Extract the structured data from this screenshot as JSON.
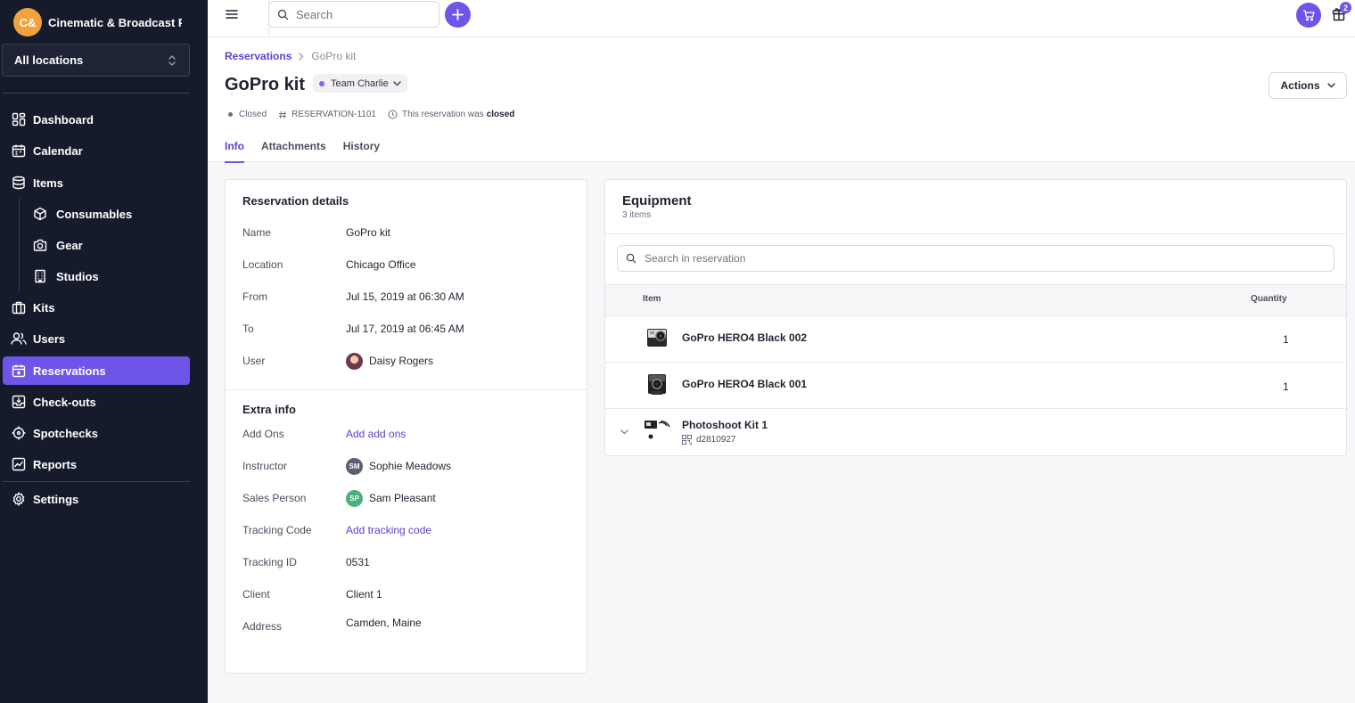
{
  "org": {
    "initials": "C&",
    "name": "Cinematic & Broadcast P..."
  },
  "location_select": {
    "value": "All locations"
  },
  "nav": {
    "dashboard": "Dashboard",
    "calendar": "Calendar",
    "items": "Items",
    "consumables": "Consumables",
    "gear": "Gear",
    "studios": "Studios",
    "kits": "Kits",
    "users": "Users",
    "reservations": "Reservations",
    "checkouts": "Check-outs",
    "spotchecks": "Spotchecks",
    "reports": "Reports",
    "settings": "Settings"
  },
  "topbar": {
    "search_placeholder": "Search",
    "gift_badge": "2"
  },
  "breadcrumb": {
    "parent": "Reservations",
    "current": "GoPro kit"
  },
  "page": {
    "title": "GoPro kit",
    "team": "Team Charlie",
    "actions_label": "Actions",
    "status": "Closed",
    "reservation_id": "RESERVATION-1101",
    "closed_note": "This reservation was",
    "closed_word": "closed"
  },
  "tabs": [
    "Info",
    "Attachments",
    "History"
  ],
  "reservation_details": {
    "title": "Reservation details",
    "rows": [
      {
        "k": "Name",
        "v": "GoPro kit"
      },
      {
        "k": "Location",
        "v": "Chicago Office"
      },
      {
        "k": "From",
        "v": "Jul 15, 2019 at 06:30 AM"
      },
      {
        "k": "To",
        "v": "Jul 17, 2019 at 06:45 AM"
      },
      {
        "k": "User",
        "v": "Daisy Rogers"
      }
    ]
  },
  "extra_info": {
    "title": "Extra info",
    "rows": [
      {
        "k": "Add Ons",
        "v": "Add add ons"
      },
      {
        "k": "Instructor",
        "v": "Sophie Meadows",
        "initials": "SM"
      },
      {
        "k": "Sales Person",
        "v": "Sam Pleasant",
        "initials": "SP"
      },
      {
        "k": "Tracking Code",
        "v": "Add tracking code"
      },
      {
        "k": "Tracking ID",
        "v": "0531"
      },
      {
        "k": "Client",
        "v": "Client 1"
      },
      {
        "k": "Address",
        "v": "Camden, Maine"
      }
    ]
  },
  "equipment": {
    "title": "Equipment",
    "count": "3 items",
    "search_placeholder": "Search in reservation",
    "col_item": "Item",
    "col_qty": "Quantity",
    "rows": [
      {
        "name": "GoPro HERO4 Black 002",
        "qty": "1"
      },
      {
        "name": "GoPro HERO4 Black 001",
        "qty": "1"
      },
      {
        "name": "Photoshoot Kit 1",
        "code": "d2810927"
      }
    ]
  },
  "colors": {
    "accent": "#6e54e8",
    "sidebar": "#161b2c",
    "org_avatar": "#f0a23c",
    "sm_avatar": "#5b6070",
    "sp_avatar": "#4caf7d"
  }
}
